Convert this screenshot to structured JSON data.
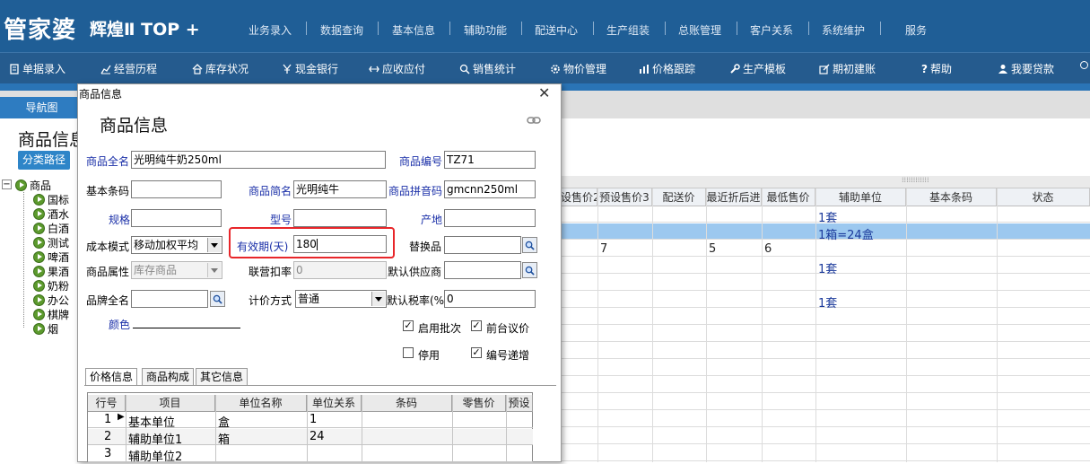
{
  "app": {
    "logo": "管家婆",
    "logo_sub": "辉煌Ⅱ TOP +"
  },
  "menu": [
    "业务录入",
    "数据查询",
    "基本信息",
    "辅助功能",
    "配送中心",
    "生产组装",
    "总账管理",
    "客户关系",
    "系统维护",
    "服务"
  ],
  "toolbar": [
    {
      "icon": "document-icon",
      "label": "单据录入"
    },
    {
      "icon": "line-chart-icon",
      "label": "经营历程"
    },
    {
      "icon": "home-icon",
      "label": "库存状况"
    },
    {
      "icon": "yen-icon",
      "label": "现金银行"
    },
    {
      "icon": "arrows-icon",
      "label": "应收应付"
    },
    {
      "icon": "search-icon",
      "label": "销售统计"
    },
    {
      "icon": "gear-icon",
      "label": "物价管理"
    },
    {
      "icon": "bar-chart-icon",
      "label": "价格跟踪"
    },
    {
      "icon": "wrench-icon",
      "label": "生产模板"
    },
    {
      "icon": "external-icon",
      "label": "期初建账"
    },
    {
      "icon": "help-icon",
      "label": "帮助"
    },
    {
      "icon": "user-icon",
      "label": "我要贷款"
    }
  ],
  "nav_tab": "导航图",
  "background_title": "商品信息",
  "path_button": "分类路径",
  "tree": {
    "root": "商品",
    "children": [
      "国标",
      "酒水",
      "白酒",
      "测试",
      "啤酒",
      "果酒",
      "奶粉",
      "办公",
      "棋牌",
      "烟"
    ]
  },
  "grid": {
    "headers": [
      "设售价2",
      "预设售价3",
      "配送价",
      "最近折后进",
      "最低售价",
      "辅助单位",
      "基本条码",
      "状态"
    ],
    "rows": [
      {
        "fu": "1套",
        "selected": false
      },
      {
        "fu": "1箱=24盒",
        "selected": true
      },
      {
        "price3": "7",
        "last_cost": "5",
        "min_price": "6"
      },
      {
        "fu": "1套"
      },
      {},
      {
        "fu": "1套"
      }
    ]
  },
  "dialog": {
    "caption": "商品信息",
    "heading": "商品信息",
    "close": "✕",
    "fields": {
      "full_name_label": "商品全名",
      "full_name": "光明纯牛奶250ml",
      "code_label": "商品编号",
      "code": "TZ71",
      "barcode_label": "基本条码",
      "barcode": "",
      "short_name_label": "商品简名",
      "short_name": "光明纯牛",
      "pinyin_label": "商品拼音码",
      "pinyin": "gmcnn250ml",
      "spec_label": "规格",
      "model_label": "型号",
      "origin_label": "产地",
      "cost_mode_label": "成本模式",
      "cost_mode": "移动加权平均",
      "shelf_life_label": "有效期(天)",
      "shelf_life": "180",
      "substitute_label": "替换品",
      "attr_label": "商品属性",
      "attr": "库存商品",
      "rebate_label": "联营扣率",
      "rebate": "0",
      "supplier_label": "默认供应商",
      "brand_label": "品牌全名",
      "pricing_label": "计价方式",
      "pricing": "普通",
      "tax_label": "默认税率(%)",
      "tax": "0",
      "color_label": "颜色"
    },
    "checks": {
      "batch_label": "启用批次",
      "batch": true,
      "counter_label": "前台议价",
      "counter": true,
      "disable_label": "停用",
      "disable": false,
      "auto_inc_label": "编号递增",
      "auto_inc": true
    },
    "subtabs": [
      "价格信息",
      "商品构成",
      "其它信息"
    ],
    "price_grid": {
      "headers": [
        "行号",
        "项目",
        "单位名称",
        "单位关系",
        "条码",
        "零售价",
        "预设"
      ],
      "rows": [
        {
          "no": "1",
          "item": "基本单位",
          "unit": "盒",
          "rel": "1"
        },
        {
          "no": "2",
          "item": "辅助单位1",
          "unit": "箱",
          "rel": "24"
        },
        {
          "no": "3",
          "item": "辅助单位2",
          "unit": "",
          "rel": ""
        }
      ]
    }
  }
}
